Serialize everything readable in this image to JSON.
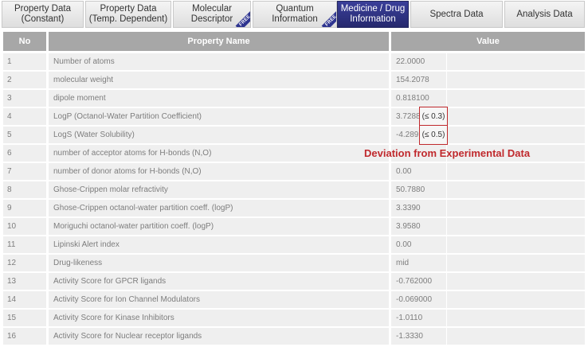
{
  "tabs": [
    {
      "line1": "Property Data",
      "line2": "(Constant)",
      "active": false,
      "free": false
    },
    {
      "line1": "Property Data",
      "line2": "(Temp. Dependent)",
      "active": false,
      "free": false
    },
    {
      "line1": "Molecular",
      "line2": "Descriptor",
      "active": false,
      "free": true
    },
    {
      "line1": "Quantum",
      "line2": "Information",
      "active": false,
      "free": true
    },
    {
      "line1": "Medicine / Drug",
      "line2": "Information",
      "active": true,
      "free": false
    },
    {
      "line1": "Spectra Data",
      "line2": "",
      "active": false,
      "free": false
    },
    {
      "line1": "Analysis Data",
      "line2": "",
      "active": false,
      "free": false
    }
  ],
  "free_badge": "FREE",
  "table": {
    "headers": {
      "no": "No",
      "property": "Property Name",
      "value": "Value"
    },
    "rows": [
      {
        "no": "1",
        "property": "Number of atoms",
        "value": "22.0000"
      },
      {
        "no": "2",
        "property": "molecular weight",
        "value": "154.2078"
      },
      {
        "no": "3",
        "property": "dipole moment",
        "value": "0.818100"
      },
      {
        "no": "4",
        "property": "LogP (Octanol-Water Partition Coefficient)",
        "value": "3.7288"
      },
      {
        "no": "5",
        "property": "LogS (Water Solubility)",
        "value": "-4.289"
      },
      {
        "no": "6",
        "property": "number of acceptor atoms for H-bonds (N,O)",
        "value": ""
      },
      {
        "no": "7",
        "property": "number of donor atoms for H-bonds (N,O)",
        "value": "0.00"
      },
      {
        "no": "8",
        "property": "Ghose-Crippen molar refractivity",
        "value": "50.7880"
      },
      {
        "no": "9",
        "property": "Ghose-Crippen octanol-water partition coeff. (logP)",
        "value": "3.3390"
      },
      {
        "no": "10",
        "property": "Moriguchi octanol-water partition coeff. (logP)",
        "value": "3.9580"
      },
      {
        "no": "11",
        "property": "Lipinski Alert index",
        "value": "0.00"
      },
      {
        "no": "12",
        "property": "Drug-likeness",
        "value": "mid"
      },
      {
        "no": "13",
        "property": "Activity Score for GPCR ligands",
        "value": "-0.762000"
      },
      {
        "no": "14",
        "property": "Activity Score for Ion Channel Modulators",
        "value": "-0.069000"
      },
      {
        "no": "15",
        "property": "Activity Score for Kinase Inhibitors",
        "value": "-1.0110"
      },
      {
        "no": "16",
        "property": "Activity Score for Nuclear receptor ligands",
        "value": "-1.3330"
      }
    ]
  },
  "annotations": {
    "logp_dev": "(≤ 0.3)",
    "logs_dev": "(≤ 0.5)",
    "label": "Deviation from Experimental Data"
  },
  "colors": {
    "active_tab": "#2c3080",
    "header": "#a7a7a7",
    "row": "#efefef",
    "annotation": "#c0292d"
  }
}
